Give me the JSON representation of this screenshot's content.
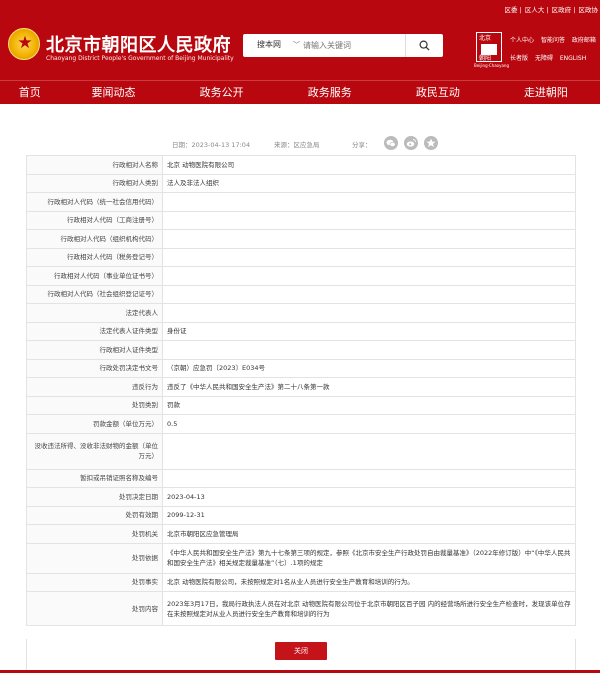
{
  "header": {
    "top_links": [
      "区委",
      "区人大",
      "区政府",
      "区政协"
    ],
    "title": "北京市朝阳区人民政府",
    "subtitle": "Chaoyang District People's Government of Beijing Municipality",
    "search": {
      "scope": "搜本网",
      "placeholder": "请输入关键词"
    },
    "qr_text": [
      "北京",
      "朝阳"
    ],
    "qr_label": "Beijing·Chaoyang",
    "quick_links_row1": [
      "个人中心",
      "智能问答",
      "政府邮箱"
    ],
    "quick_links_row2": [
      "长者版",
      "无障碍",
      "ENGLISH"
    ]
  },
  "nav": [
    "首页",
    "要闻动态",
    "政务公开",
    "政务服务",
    "政民互动",
    "走进朝阳"
  ],
  "meta": {
    "date_label": "日期：",
    "date": "2023-04-13 17:04",
    "source_label": "来源：",
    "source": "区应急局",
    "share_label": "分享："
  },
  "rows": [
    {
      "label": "行政相对人名称",
      "value": "北京              动物医院有限公司"
    },
    {
      "label": "行政相对人类别",
      "value": "法人及非法人组织"
    },
    {
      "label": "行政相对人代码（统一社会信用代码）",
      "value": ""
    },
    {
      "label": "行政相对人代码（工商注册号）",
      "value": ""
    },
    {
      "label": "行政相对人代码（组织机构代码）",
      "value": ""
    },
    {
      "label": "行政相对人代码（税务登记号）",
      "value": ""
    },
    {
      "label": "行政相对人代码（事业单位证书号）",
      "value": ""
    },
    {
      "label": "行政相对人代码（社会组织登记证号）",
      "value": ""
    },
    {
      "label": "法定代表人",
      "value": ""
    },
    {
      "label": "法定代表人证件类型",
      "value": "身份证"
    },
    {
      "label": "行政相对人证件类型",
      "value": ""
    },
    {
      "label": "行政处罚决定书文号",
      "value": "（京朝）应急罚〔2023〕E034号"
    },
    {
      "label": "违反行为",
      "value": "违反了《中华人民共和国安全生产法》第二十八条第一款"
    },
    {
      "label": "处罚类别",
      "value": "罚款"
    },
    {
      "label": "罚款金额（单位万元）",
      "value": "0.5"
    },
    {
      "label": "没收违法所得、没收非法财物的金额（单位万元）",
      "value": ""
    },
    {
      "label": "暂扣或吊销证照名称及编号",
      "value": ""
    },
    {
      "label": "处罚决定日期",
      "value": "2023-04-13"
    },
    {
      "label": "处罚有效期",
      "value": "2099-12-31"
    },
    {
      "label": "处罚机关",
      "value": "北京市朝阳区应急管理局"
    },
    {
      "label": "处罚依据",
      "value": "《中华人民共和国安全生产法》第九十七条第三项的规定，参照《北京市安全生产行政处罚自由裁量基准》（2022年修订版）中“《中华人民共和国安全生产法》相关规定裁量基准”（七）.1项的规定"
    },
    {
      "label": "处罚事实",
      "value": "北京              动物医院有限公司，未按照规定对1名从业人员进行安全生产教育和培训的行为。"
    },
    {
      "label": "处罚内容",
      "value": "2023年3月17日，我局行政执法人员在对北京              动物医院有限公司位于北京市朝阳区百子园              内的经营场所进行安全生产检查时，发现该单位存在未按照规定对从业人员进行安全生产教育和培训的行为"
    }
  ],
  "close_label": "关闭",
  "colors": {
    "brand_red": "#b8070e",
    "button_red": "#c4141a"
  }
}
